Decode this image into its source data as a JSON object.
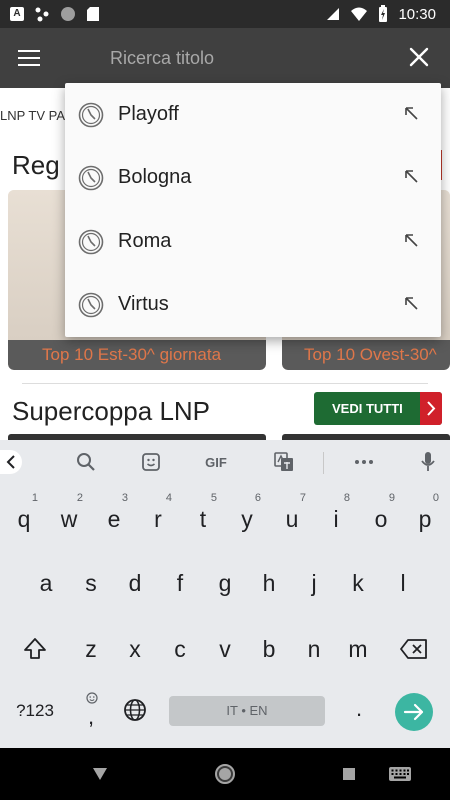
{
  "status_bar": {
    "time": "10:30",
    "notif_letter": "A"
  },
  "app_bar": {
    "search_placeholder": "Ricerca titolo"
  },
  "background": {
    "tabs_strip_text": "LNP TV PA",
    "section1_title": "Reg",
    "cards": [
      {
        "caption": "Top 10 Est-30^ giornata"
      },
      {
        "caption": "Top 10 Ovest-30^"
      }
    ],
    "section2_title": "Supercoppa LNP",
    "see_all_label": "VEDI TUTTI"
  },
  "suggestions": [
    {
      "text": "Playoff"
    },
    {
      "text": "Bologna"
    },
    {
      "text": "Roma"
    },
    {
      "text": "Virtus"
    }
  ],
  "keyboard": {
    "toolbar_gif": "GIF",
    "row1": [
      {
        "key": "q",
        "hint": "1"
      },
      {
        "key": "w",
        "hint": "2"
      },
      {
        "key": "e",
        "hint": "3"
      },
      {
        "key": "r",
        "hint": "4"
      },
      {
        "key": "t",
        "hint": "5"
      },
      {
        "key": "y",
        "hint": "6"
      },
      {
        "key": "u",
        "hint": "7"
      },
      {
        "key": "i",
        "hint": "8"
      },
      {
        "key": "o",
        "hint": "9"
      },
      {
        "key": "p",
        "hint": "0"
      }
    ],
    "row2": [
      "a",
      "s",
      "d",
      "f",
      "g",
      "h",
      "j",
      "k",
      "l"
    ],
    "row3": [
      "z",
      "x",
      "c",
      "v",
      "b",
      "n",
      "m"
    ],
    "symbols_label": "?123",
    "comma": ",",
    "period": ".",
    "space_label": "IT • EN"
  },
  "colors": {
    "app_bar": "#404040",
    "status_bar": "#2b2b2b",
    "caption_orange": "#e0774a",
    "see_all_green": "#1e6b33",
    "enter_teal": "#3cb6a2"
  }
}
